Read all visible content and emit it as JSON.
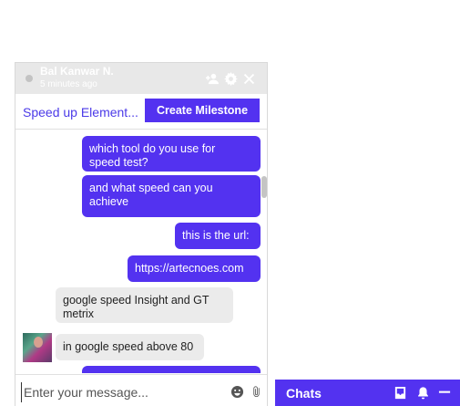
{
  "chat": {
    "contact_name": "Bal Kanwar N.",
    "last_seen": "5 minutes ago",
    "status_color": "#c3c3c3",
    "header_icons": [
      "add-user-icon",
      "gear-icon",
      "close-icon"
    ],
    "project_link": "Speed up Element...",
    "milestone_button": "Create Milestone",
    "messages": [
      {
        "direction": "out",
        "text": "which tool do you use for\nspeed test?"
      },
      {
        "direction": "out",
        "text": "and what speed can you\nachieve"
      },
      {
        "direction": "out",
        "text": "this is the url:"
      },
      {
        "direction": "out",
        "text": "https://artecnoes.com"
      },
      {
        "direction": "in",
        "text": "google speed Insight and GT\nmetrix"
      },
      {
        "direction": "in",
        "text": "in google speed above 80"
      },
      {
        "direction": "out",
        "text": ""
      }
    ],
    "composer": {
      "placeholder": "Enter your message...",
      "icons": [
        "emoji-icon",
        "paperclip-icon"
      ]
    }
  },
  "chats_bar": {
    "label": "Chats",
    "icons": [
      "inbox-icon",
      "bell-icon",
      "minimize-icon"
    ]
  },
  "colors": {
    "accent": "#5332f0",
    "header_bg": "#e8e8e8",
    "incoming_bubble": "#ebebeb"
  }
}
